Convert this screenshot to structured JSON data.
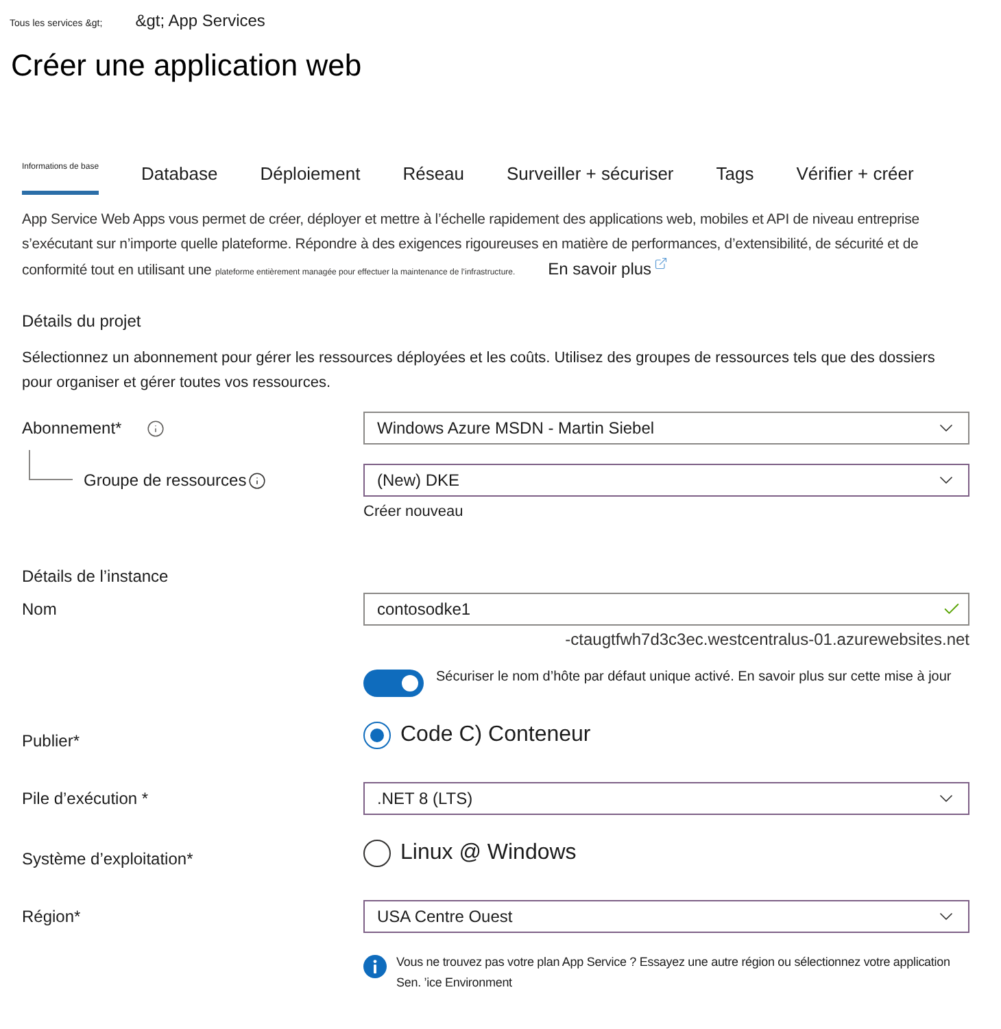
{
  "breadcrumb": [
    {
      "label": "Tous les services &gt;",
      "kind": "small"
    },
    {
      "label": "&gt; App Services",
      "kind": "normal"
    }
  ],
  "title": "Créer une application web",
  "tabs": [
    {
      "label": "Informations de base",
      "selected": true,
      "kind": "small"
    },
    {
      "label": "Database",
      "selected": false,
      "kind": "normal"
    },
    {
      "label": "Déploiement",
      "selected": false,
      "kind": "normal"
    },
    {
      "label": "Réseau",
      "selected": false,
      "kind": "normal"
    },
    {
      "label": "Surveiller + sécuriser",
      "selected": false,
      "kind": "normal"
    },
    {
      "label": "Tags",
      "selected": false,
      "kind": "normal"
    },
    {
      "label": "Vérifier + créer",
      "selected": false,
      "kind": "normal"
    }
  ],
  "description": {
    "text": "App Service Web Apps vous permet de créer, déployer et mettre à l’échelle rapidement des applications web, mobiles et API de niveau entreprise s’exécutant sur n’importe quelle plateforme. Répondre à des exigences rigoureuses en matière de performances, d’extensibilité, de sécurité et de conformité tout en utilisant une",
    "small_text": "plateforme entièrement managée pour effectuer la maintenance de l’infrastructure.",
    "link": "En savoir plus"
  },
  "project_details": {
    "heading": "Détails du projet",
    "text": "Sélectionnez un abonnement pour gérer les ressources déployées et les coûts. Utilisez des groupes de ressources tels que des dossiers pour organiser et gérer toutes vos ressources.",
    "subscription": {
      "label": "Abonnement*",
      "value": "Windows Azure MSDN - Martin Siebel",
      "highlighted": false
    },
    "resource_group": {
      "label": "Groupe de ressources",
      "value": "(New) DKE",
      "highlighted": true,
      "create_new": "Créer nouveau"
    }
  },
  "instance_details": {
    "heading": "Détails de l’instance",
    "name": {
      "label": "Nom",
      "value": "contosodke1",
      "valid": true,
      "hint": "-ctaugtfwh7d3c3ec.westcentralus-01.azurewebsites.net"
    },
    "secure_hostname": {
      "on": true,
      "text": "Sécuriser le nom d’hôte par défaut unique activé. En savoir plus sur cette mise à jour"
    },
    "publish": {
      "label": "Publier*",
      "options": [
        {
          "label": "Code C) Conteneur",
          "selected": true
        }
      ]
    },
    "runtime_stack": {
      "label": "Pile d’exécution *",
      "value": ".NET 8 (LTS)",
      "highlighted": true
    },
    "operating_system": {
      "label": "Système d’exploitation*",
      "options": [
        {
          "label": "Linux @ Windows",
          "selected": false
        }
      ]
    },
    "region": {
      "label": "Région*",
      "value": "USA Centre Ouest",
      "highlighted": true
    },
    "info": {
      "lines": [
        "Vous ne trouvez pas votre plan App Service ? Essayez une autre région ou sélectionnez votre application",
        "Sen. ’ice Environment"
      ]
    }
  }
}
